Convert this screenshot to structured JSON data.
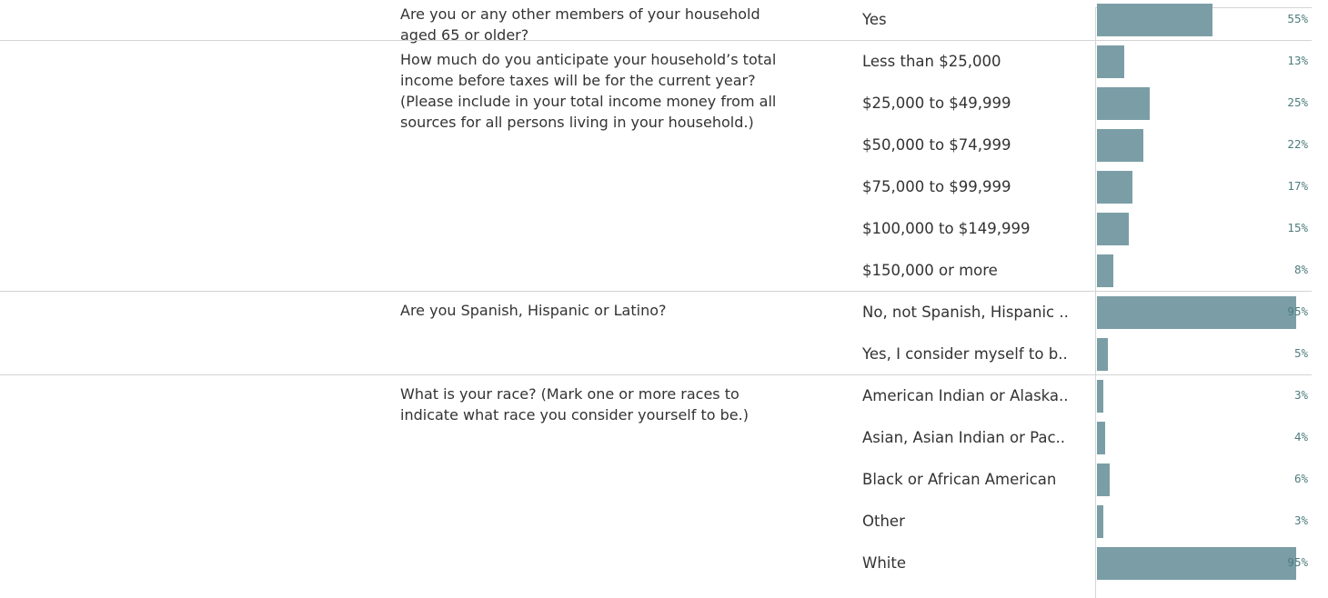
{
  "style": {
    "bar_color": "#7b9ea6",
    "pct_color": "#4f7d7f",
    "text_color": "#333333",
    "divider_color": "#d4d4d4"
  },
  "chart_data": {
    "type": "bar",
    "orientation": "horizontal",
    "unit": "%",
    "xlim": [
      0,
      100
    ],
    "grid": false,
    "groups": [
      {
        "question": "Are you or any other members of your household\naged 65 or older?",
        "rows": [
          {
            "label": "Yes",
            "value": 55,
            "value_label": "55%"
          }
        ]
      },
      {
        "question": "How much do you anticipate your household’s total\nincome before taxes will be for the current year?\n(Please include in your total income money from all\nsources for all persons living in your household.)",
        "rows": [
          {
            "label": "Less than $25,000",
            "value": 13,
            "value_label": "13%"
          },
          {
            "label": "$25,000 to $49,999",
            "value": 25,
            "value_label": "25%"
          },
          {
            "label": "$50,000 to $74,999",
            "value": 22,
            "value_label": "22%"
          },
          {
            "label": "$75,000 to $99,999",
            "value": 17,
            "value_label": "17%"
          },
          {
            "label": "$100,000 to $149,999",
            "value": 15,
            "value_label": "15%"
          },
          {
            "label": "$150,000 or more",
            "value": 8,
            "value_label": "8%"
          }
        ]
      },
      {
        "question": "Are you Spanish, Hispanic or Latino?",
        "rows": [
          {
            "label": "No, not Spanish, Hispanic ..",
            "value": 95,
            "value_label": "95%"
          },
          {
            "label": "Yes, I consider myself to b..",
            "value": 5,
            "value_label": "5%"
          }
        ]
      },
      {
        "question": "What is your race? (Mark one or more races to\nindicate what race you consider yourself to be.)",
        "rows": [
          {
            "label": "American Indian or Alaska..",
            "value": 3,
            "value_label": "3%"
          },
          {
            "label": "Asian, Asian Indian or Pac..",
            "value": 4,
            "value_label": "4%"
          },
          {
            "label": "Black or African American",
            "value": 6,
            "value_label": "6%"
          },
          {
            "label": "Other",
            "value": 3,
            "value_label": "3%"
          },
          {
            "label": "White",
            "value": 95,
            "value_label": "95%"
          }
        ]
      }
    ]
  }
}
